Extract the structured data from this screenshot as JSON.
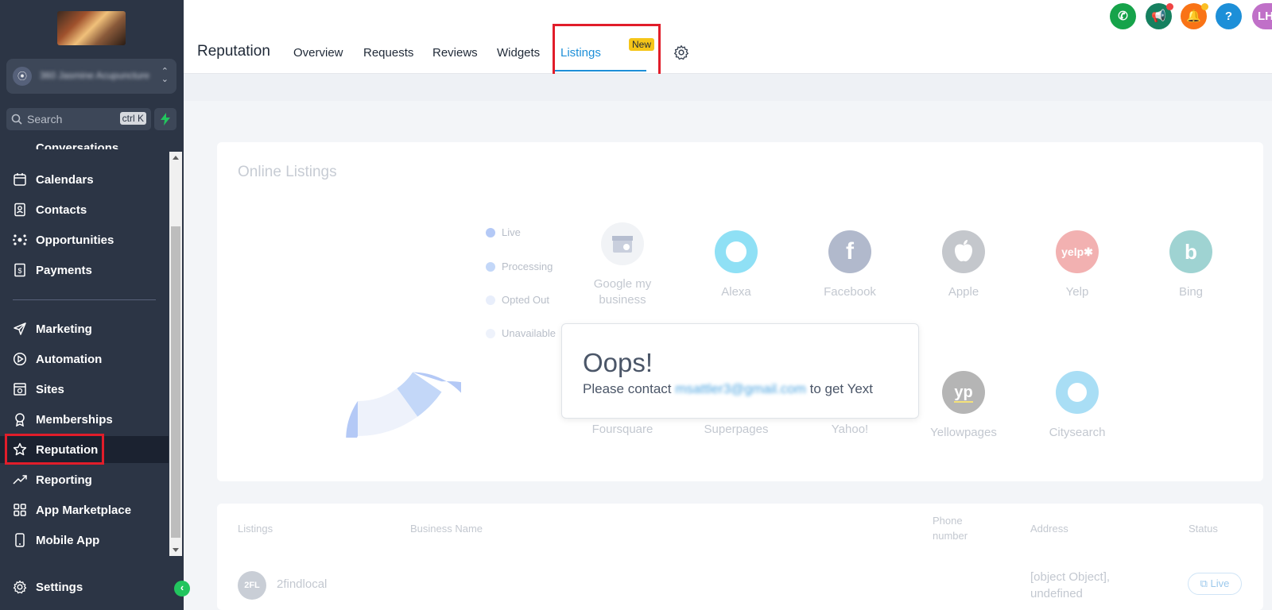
{
  "sidebar": {
    "search_placeholder": "Search",
    "search_shortcut": "ctrl K",
    "account_name": "360 Jasmine Acupuncture",
    "cut_item_label": "Conversations",
    "items": [
      {
        "label": "Calendars",
        "icon": "calendar-icon"
      },
      {
        "label": "Contacts",
        "icon": "contacts-icon"
      },
      {
        "label": "Opportunities",
        "icon": "opportunities-icon"
      },
      {
        "label": "Payments",
        "icon": "payments-icon"
      },
      {
        "label": "Marketing",
        "icon": "send-icon"
      },
      {
        "label": "Automation",
        "icon": "automation-icon"
      },
      {
        "label": "Sites",
        "icon": "sites-icon"
      },
      {
        "label": "Memberships",
        "icon": "award-icon"
      },
      {
        "label": "Reputation",
        "icon": "star-icon"
      },
      {
        "label": "Reporting",
        "icon": "trending-icon"
      },
      {
        "label": "App Marketplace",
        "icon": "grid-icon"
      },
      {
        "label": "Mobile App",
        "icon": "mobile-icon"
      }
    ],
    "settings_label": "Settings",
    "active_item": "Reputation"
  },
  "header": {
    "page_title": "Reputation",
    "tabs": [
      {
        "label": "Overview"
      },
      {
        "label": "Requests"
      },
      {
        "label": "Reviews"
      },
      {
        "label": "Widgets"
      },
      {
        "label": "Listings"
      }
    ],
    "active_tab": "Listings",
    "new_badge": "New",
    "avatar_initials": "LH"
  },
  "online_listings": {
    "title": "Online Listings",
    "legend": [
      {
        "label": "Live",
        "color": "#b4c9f6"
      },
      {
        "label": "Processing",
        "color": "#c3d7f8"
      },
      {
        "label": "Opted Out",
        "color": "#e8eefb"
      },
      {
        "label": "Unavailable",
        "color": "#eef2fb"
      }
    ],
    "listings_row1": [
      {
        "name": "Google my business",
        "icon": "google-my-business-icon",
        "color": "#f1f3f6"
      },
      {
        "name": "Alexa",
        "icon": "alexa-icon",
        "color": "#8fe0f5"
      },
      {
        "name": "Facebook",
        "icon": "facebook-icon",
        "color": "#b1b9cc"
      },
      {
        "name": "Apple",
        "icon": "apple-icon",
        "color": "#c4c7cc"
      },
      {
        "name": "Yelp",
        "icon": "yelp-icon",
        "color": "#f2b1b1"
      },
      {
        "name": "Bing",
        "icon": "bing-icon",
        "color": "#9fd3d2"
      }
    ],
    "listings_row2": [
      {
        "name": "Foursquare"
      },
      {
        "name": "Superpages"
      },
      {
        "name": "Yahoo!"
      },
      {
        "name": "Yellowpages",
        "icon": "yellowpages-icon",
        "color": "#b5b5b5"
      },
      {
        "name": "Citysearch",
        "icon": "citysearch-icon",
        "color": "#a9def5"
      }
    ],
    "oops": {
      "title": "Oops!",
      "message_prefix": "Please contact",
      "email": "msattler3@gmail.com",
      "message_suffix": "to get Yext"
    }
  },
  "table": {
    "headers": [
      "Listings",
      "Business Name",
      "Phone number",
      "Address",
      "Status"
    ],
    "rows": [
      {
        "avatar": "2FL",
        "listing": "2findlocal",
        "address_line1": "[object Object],",
        "address_line2": "undefined",
        "status": "Live"
      }
    ]
  }
}
